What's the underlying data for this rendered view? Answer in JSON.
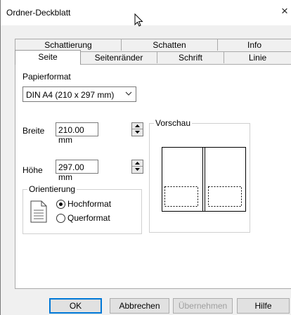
{
  "window": {
    "title": "Ordner-Deckblatt",
    "close_glyph": "×"
  },
  "tabs_back": [
    "Schattierung",
    "Schatten",
    "Info"
  ],
  "tabs_front": [
    "Seite",
    "Seitenränder",
    "Schrift",
    "Linie"
  ],
  "active_tab": "Seite",
  "page": {
    "paper_format_label": "Papierformat",
    "paper_format_value": "DIN A4 (210 x 297 mm)",
    "width_label": "Breite",
    "width_value": "210.00 mm",
    "height_label": "Höhe",
    "height_value": "297.00 mm",
    "orientation_label": "Orientierung",
    "orientation_options": [
      "Hochformat",
      "Querformat"
    ],
    "orientation_selected": "Hochformat",
    "preview_label": "Vorschau"
  },
  "buttons": {
    "ok": "OK",
    "cancel": "Abbrechen",
    "apply": "Übernehmen",
    "help": "Hilfe"
  },
  "icons": {
    "cursor": "mouse-pointer-icon",
    "close": "close-icon",
    "dropdown": "chevron-down-icon",
    "spin_up": "spin-up-icon",
    "spin_down": "spin-down-icon",
    "orientation": "portrait-page-icon"
  },
  "colors": {
    "default_button_border": "#0078d7",
    "disabled_text": "#a0a0a0",
    "dialog_background": "#f0f0f0"
  }
}
